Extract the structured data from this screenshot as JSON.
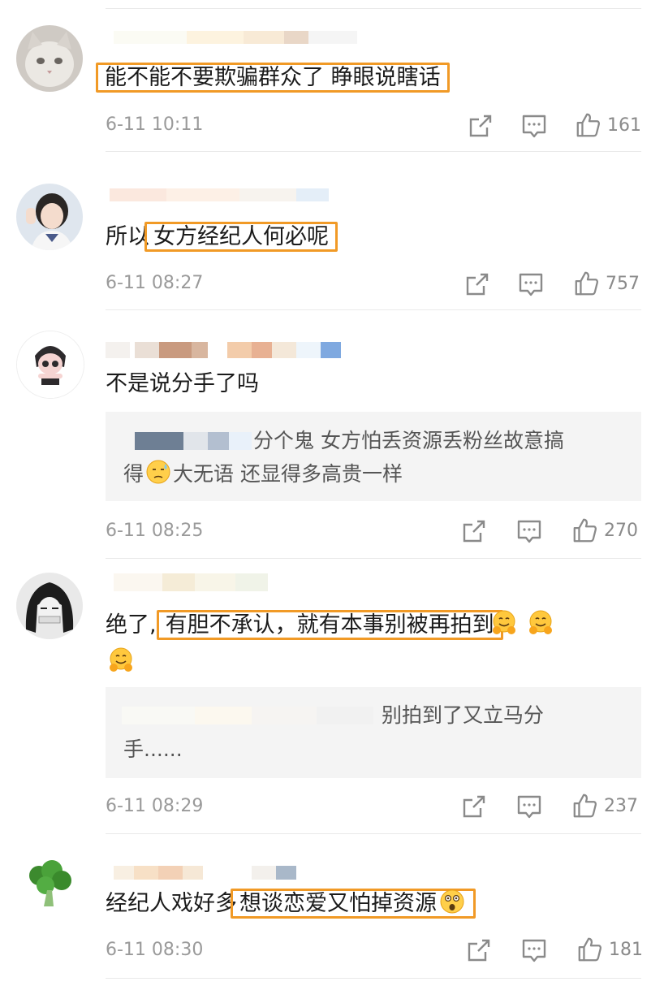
{
  "comments": [
    {
      "text_before": "",
      "text_hl": "能不能不要欺骗群众了 睁眼说瞎话",
      "text_after": "",
      "time": "6-11 10:11",
      "likes": "161"
    },
    {
      "text_before": "所以",
      "text_hl": "女方经纪人何必呢",
      "text_after": "",
      "time": "6-11 08:27",
      "likes": "757"
    },
    {
      "text": "不是说分手了吗",
      "reply_line1": "分个鬼 女方怕丢资源丢粉丝故意搞",
      "reply_line2a": "得",
      "reply_line2b": "大无语 还显得多高贵一样",
      "time": "6-11 08:25",
      "likes": "270"
    },
    {
      "text_before": "绝了,",
      "text_hl": "有胆不承认，就有本事别被再拍到",
      "reply_line1": "别拍到了又立马分",
      "reply_line2": "手......",
      "time": "6-11 08:29",
      "likes": "237"
    },
    {
      "text_before": "经纪人戏好多",
      "text_hl": "想谈恋爱又怕掉资源",
      "time": "6-11 08:30",
      "likes": "181"
    }
  ],
  "icons": {
    "share": "share-icon",
    "comment": "comment-icon",
    "like": "thumbs-up-icon",
    "emoji_hug": "hugging-face-emoji",
    "emoji_sweat": "sweat-face-emoji",
    "emoji_astonished": "astonished-face-emoji"
  },
  "colors": {
    "highlight_border": "#f19a26",
    "meta_text": "#9a9a9a",
    "reply_bg": "#f4f4f4"
  }
}
